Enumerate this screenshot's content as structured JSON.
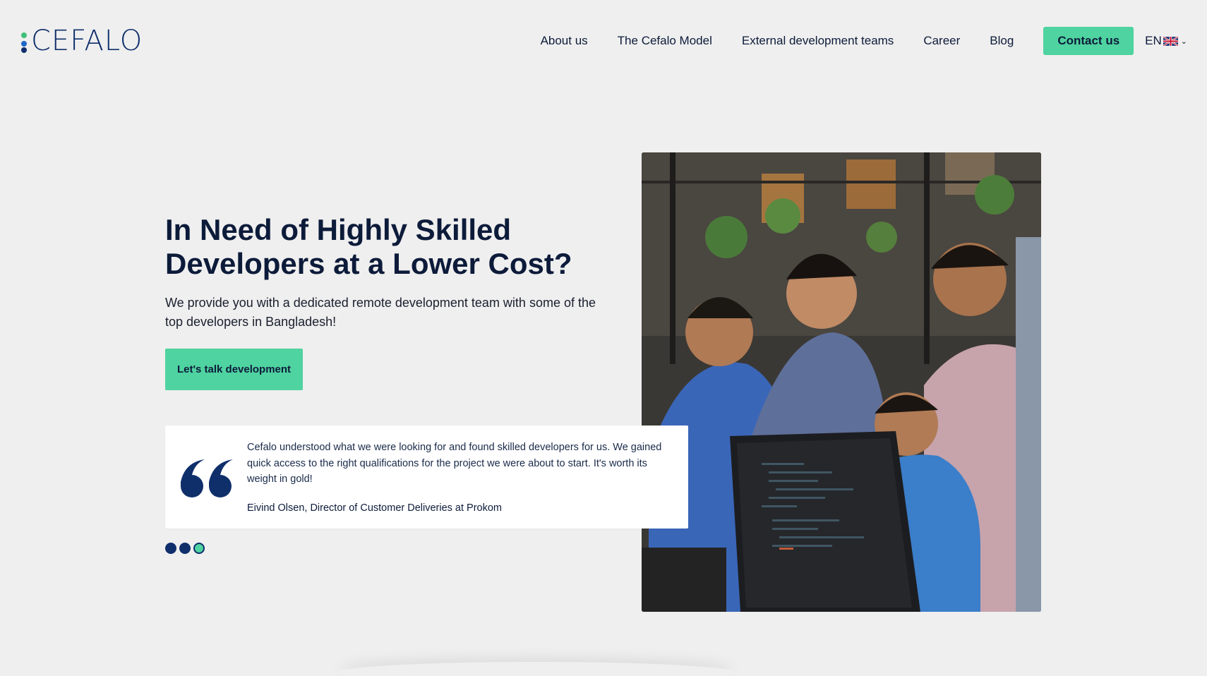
{
  "header": {
    "logo_text": "CEFALO",
    "nav": [
      {
        "label": "About us"
      },
      {
        "label": "The Cefalo Model"
      },
      {
        "label": "External development teams"
      },
      {
        "label": "Career"
      },
      {
        "label": "Blog"
      }
    ],
    "contact_label": "Contact us",
    "language": "EN",
    "language_icon": "uk-flag-icon"
  },
  "hero": {
    "title": "In Need of Highly Skilled Developers at a Lower Cost?",
    "subtitle": "We provide you with a dedicated remote development team with some of the top developers in Bangladesh!",
    "cta_label": "Let's talk development",
    "photo_alt": "Team of developers smiling around a computer"
  },
  "testimonial": {
    "quote": "Cefalo understood what we were looking for and found skilled developers for us. We gained quick access to the right qualifications for the project we were about to start. It's worth its weight in gold!",
    "author": "Eivind Olsen, Director of Customer Deliveries at Prokom",
    "slides_total": 3,
    "active_slide": 3
  },
  "colors": {
    "accent": "#4fd3a0",
    "navy": "#0f2f6b",
    "background": "#efefef"
  }
}
